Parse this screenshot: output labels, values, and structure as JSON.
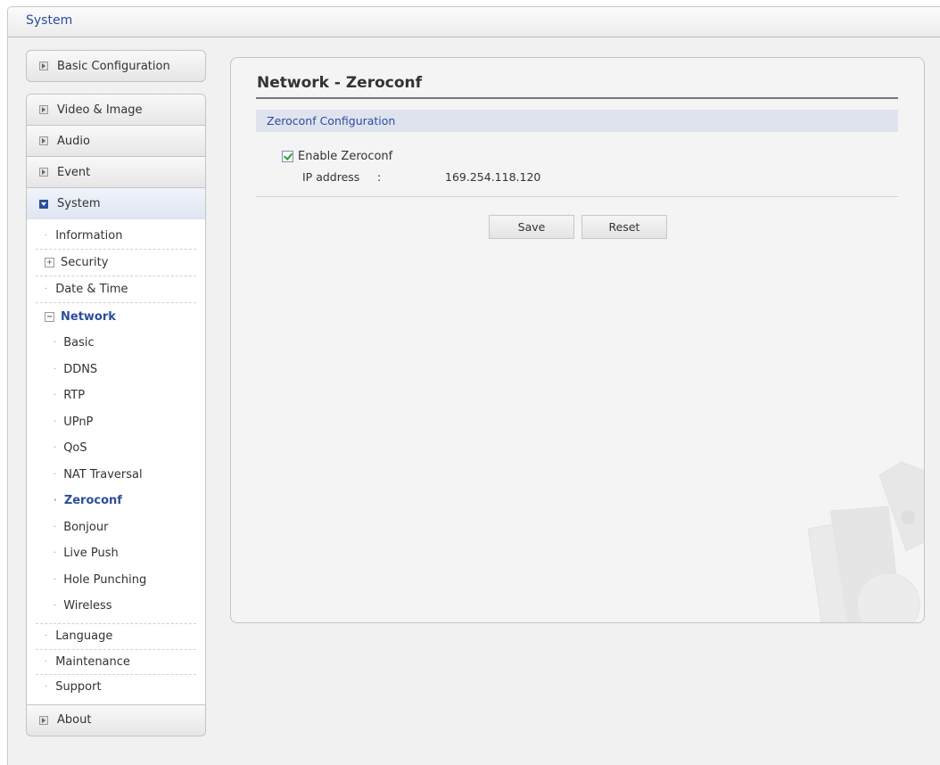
{
  "header": {
    "title": "System"
  },
  "sidebar": {
    "basic_configuration": "Basic Configuration",
    "groups": [
      "Video & Image",
      "Audio",
      "Event",
      "System"
    ],
    "system_items": {
      "information": "Information",
      "security": "Security",
      "date_time": "Date & Time",
      "network": "Network",
      "network_children": [
        "Basic",
        "DDNS",
        "RTP",
        "UPnP",
        "QoS",
        "NAT Traversal",
        "Zeroconf",
        "Bonjour",
        "Live Push",
        "Hole Punching",
        "Wireless"
      ],
      "language": "Language",
      "maintenance": "Maintenance",
      "support": "Support"
    },
    "about": "About"
  },
  "main": {
    "title": "Network - Zeroconf",
    "section": "Zeroconf Configuration",
    "enable_label": "Enable Zeroconf",
    "enable_checked": true,
    "ip_label": "IP address",
    "ip_colon": ":",
    "ip_value": "169.254.118.120",
    "save_label": "Save",
    "reset_label": "Reset"
  }
}
